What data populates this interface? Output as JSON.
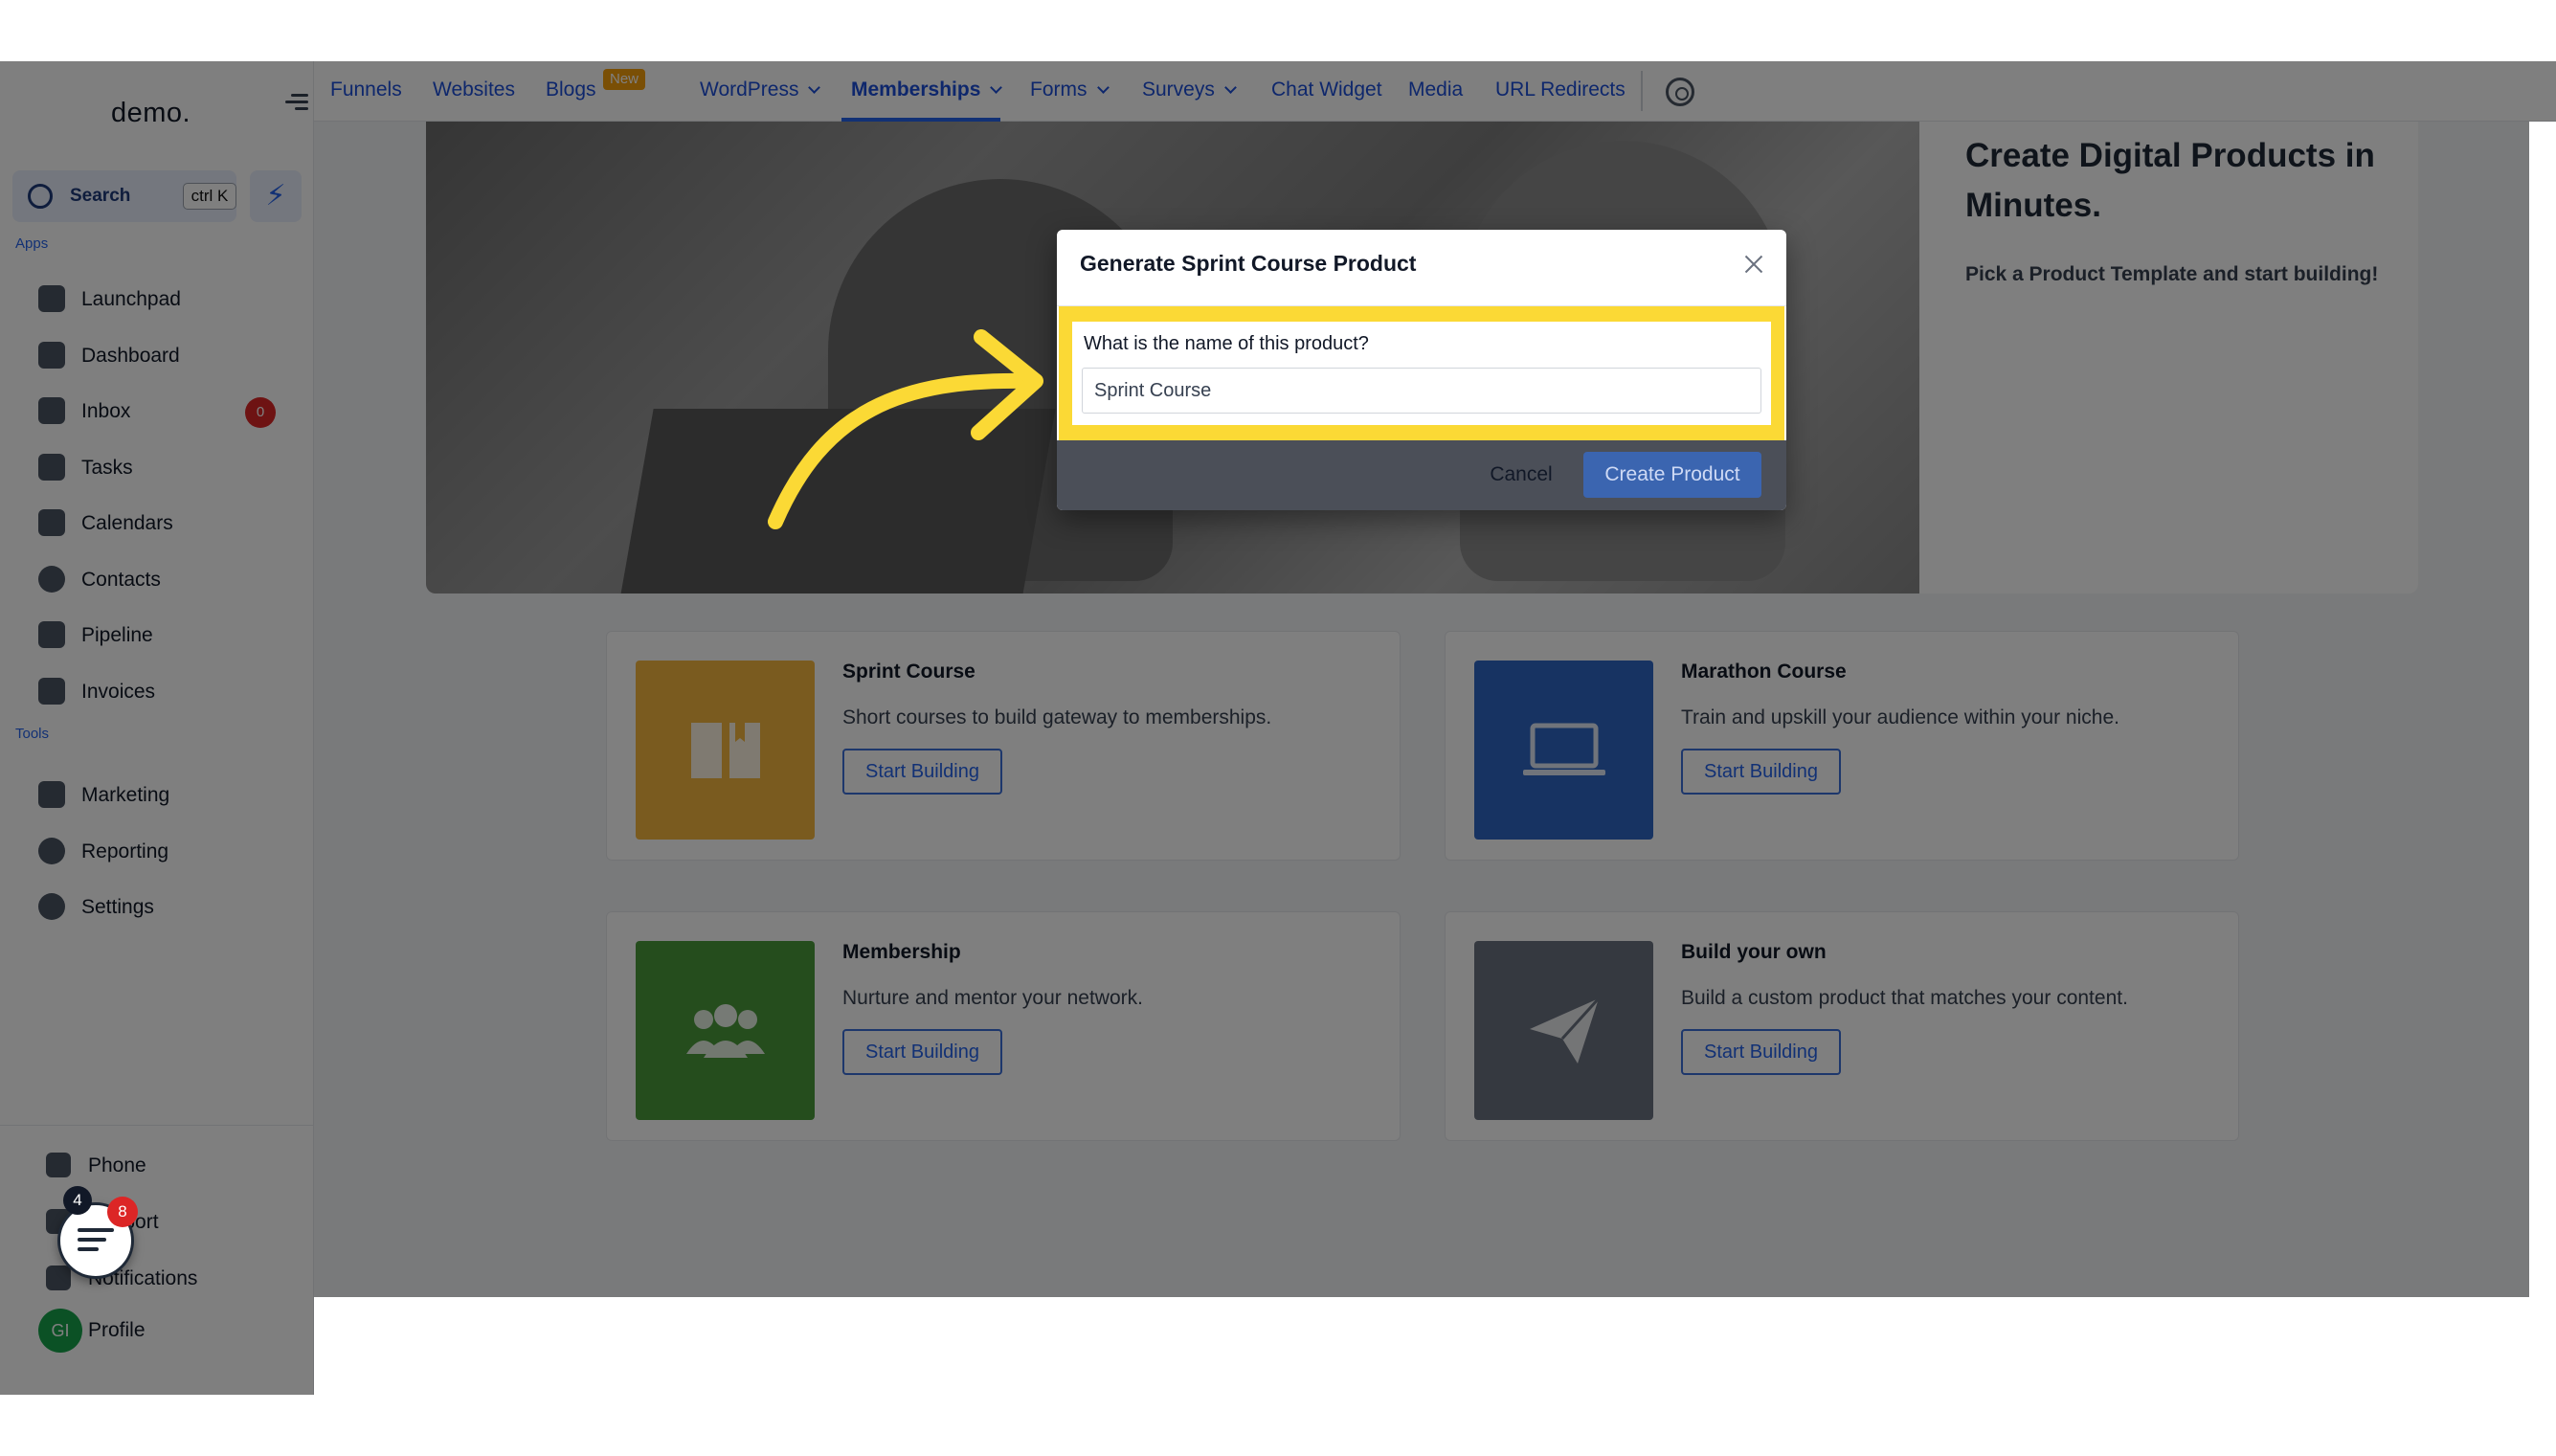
{
  "app": {
    "logo": "demo.",
    "search_label": "Search",
    "search_shortcut": "ctrl K",
    "apps_label": "Apps",
    "tools_label": "Tools"
  },
  "sidebar": {
    "apps": [
      {
        "label": "Launchpad",
        "icon": "rocket-icon"
      },
      {
        "label": "Dashboard",
        "icon": "dashboard-icon"
      },
      {
        "label": "Inbox",
        "icon": "inbox-icon",
        "badge": "0"
      },
      {
        "label": "Tasks",
        "icon": "tasks-icon"
      },
      {
        "label": "Calendars",
        "icon": "calendar-icon"
      },
      {
        "label": "Contacts",
        "icon": "contacts-icon"
      },
      {
        "label": "Pipeline",
        "icon": "pipeline-icon"
      },
      {
        "label": "Invoices",
        "icon": "invoice-icon"
      }
    ],
    "tools": [
      {
        "label": "Marketing",
        "icon": "megaphone-icon"
      },
      {
        "label": "Reporting",
        "icon": "chart-pie-icon"
      },
      {
        "label": "Settings",
        "icon": "gear-icon"
      }
    ],
    "bottom": [
      {
        "label": "Phone",
        "icon": "phone-icon"
      },
      {
        "label": "Support",
        "icon": "support-icon"
      },
      {
        "label": "Notifications",
        "icon": "bell-icon"
      },
      {
        "label": "Profile",
        "icon": "avatar"
      }
    ],
    "notif_count": "4",
    "chat_badge": "8",
    "avatar_initials": "GI"
  },
  "topnav": {
    "tabs": [
      {
        "label": "Funnels"
      },
      {
        "label": "Websites"
      },
      {
        "label": "Blogs",
        "badge": "New"
      },
      {
        "label": "WordPress",
        "dropdown": true
      },
      {
        "label": "Memberships",
        "dropdown": true,
        "active": true
      },
      {
        "label": "Forms",
        "dropdown": true
      },
      {
        "label": "Surveys",
        "dropdown": true
      },
      {
        "label": "Chat Widget"
      },
      {
        "label": "Media"
      },
      {
        "label": "URL Redirects"
      }
    ]
  },
  "hero": {
    "title": "Create Digital Products in Minutes.",
    "subtitle": "Pick a Product Template and start building!"
  },
  "products": [
    {
      "title": "Sprint Course",
      "desc": "Short courses to build gateway to memberships.",
      "button": "Start Building",
      "color": "#f4b73f",
      "icon": "book-icon"
    },
    {
      "title": "Marathon Course",
      "desc": "Train and upskill your audience within your niche.",
      "button": "Start Building",
      "color": "#2f66c4",
      "icon": "laptop-icon"
    },
    {
      "title": "Membership",
      "desc": "Nurture and mentor your network.",
      "button": "Start Building",
      "color": "#4a9a3b",
      "icon": "users-icon"
    },
    {
      "title": "Build your own",
      "desc": "Build a custom product that matches your content.",
      "button": "Start Building",
      "color": "#6b7280",
      "icon": "paper-plane-icon"
    }
  ],
  "modal": {
    "title": "Generate Sprint Course Product",
    "field_label": "What is the name of this product?",
    "field_value": "Sprint Course",
    "cancel": "Cancel",
    "create": "Create Product",
    "highlight_color": "#fbd935"
  }
}
